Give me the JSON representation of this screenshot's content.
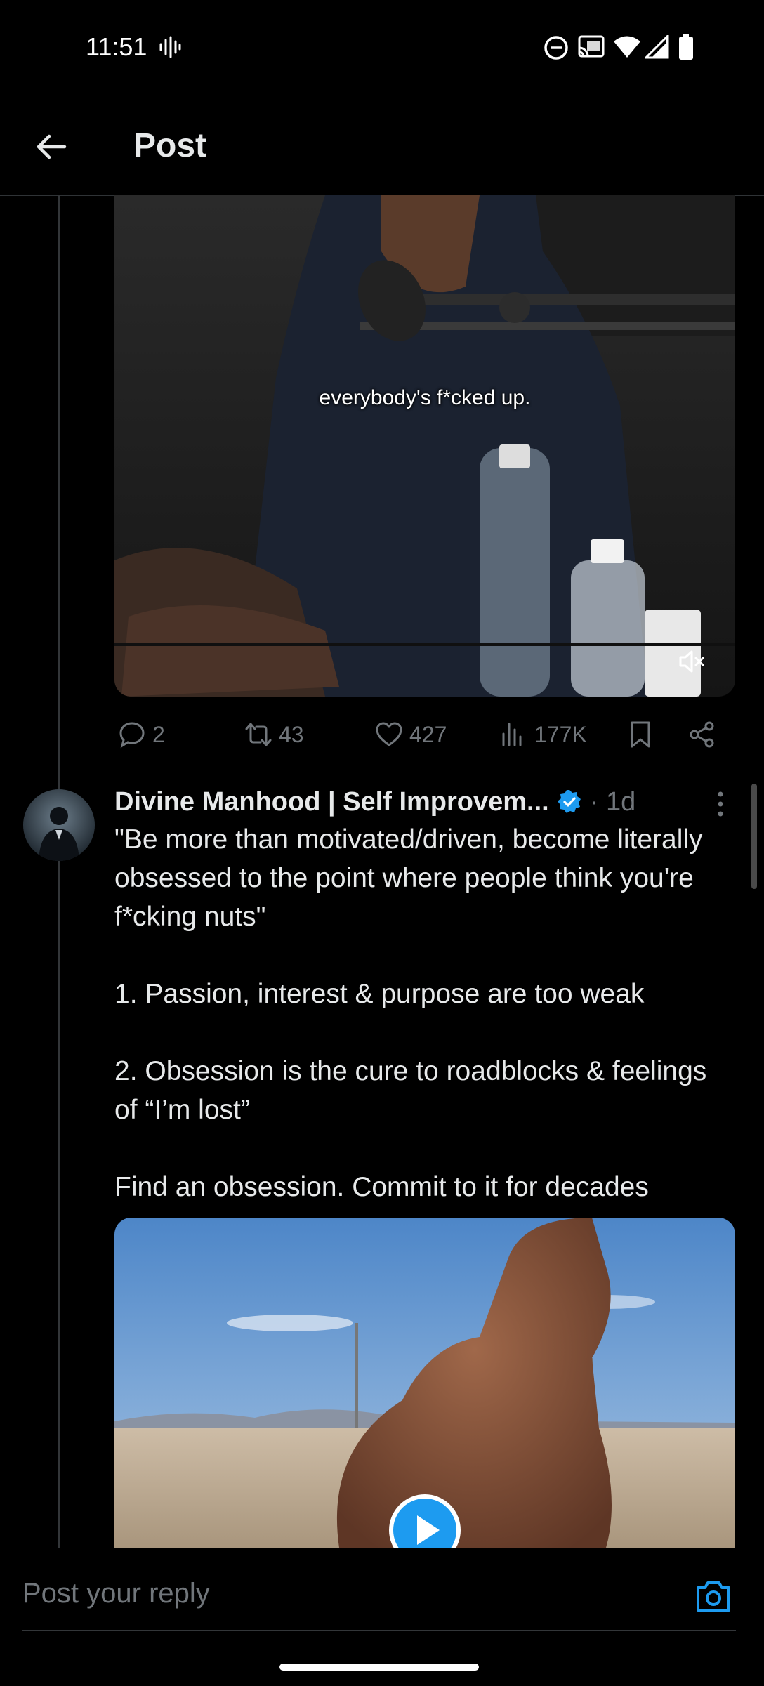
{
  "status_bar": {
    "time": "11:51"
  },
  "header": {
    "title": "Post"
  },
  "media1": {
    "caption": "everybody's f*cked up."
  },
  "actions": {
    "replies": "2",
    "reposts": "43",
    "likes": "427",
    "views": "177K"
  },
  "post": {
    "author": "Divine Manhood | Self Improvem...",
    "time": "· 1d",
    "paragraphs": [
      "\"Be more than motivated/driven, become literally obsessed to the point where people think you're f*cking nuts\"",
      "1. Passion, interest & purpose are too weak",
      "2. Obsession is the cure to roadblocks & feelings of “I’m lost”",
      "Find an obsession. Commit to it for decades"
    ]
  },
  "reply": {
    "placeholder": "Post your reply"
  },
  "colors": {
    "background": "#000000",
    "text": "#e7e9ea",
    "muted": "#71767b",
    "accent": "#1d9bf0",
    "divider": "#2f3336"
  }
}
